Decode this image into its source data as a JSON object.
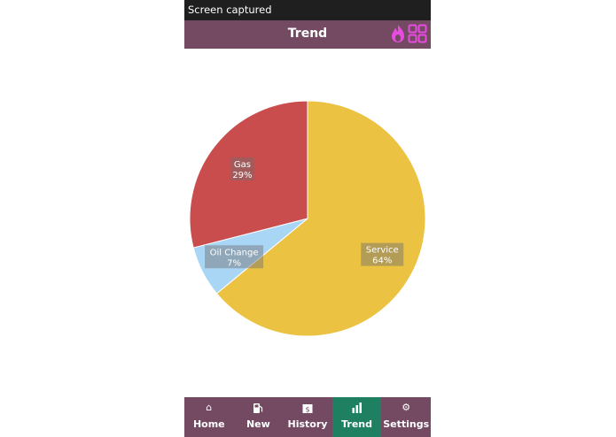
{
  "status_bar": {
    "text": "Screen captured"
  },
  "header": {
    "title": "Trend",
    "icons": [
      "flame-icon",
      "apps-grid-icon"
    ]
  },
  "colors": {
    "header_bg": "#734a62",
    "active_tab_bg": "#1e8060",
    "accent_icon": "#e84be0",
    "service": "#ecc243",
    "gas": "#c94d4d",
    "oil_change": "#aad6f5"
  },
  "chart_data": {
    "type": "pie",
    "slices": [
      {
        "label": "Service",
        "value": 64,
        "percent_label": "64%",
        "color": "#ecc243"
      },
      {
        "label": "Oil Change",
        "value": 7,
        "percent_label": "7%",
        "color": "#aad6f5"
      },
      {
        "label": "Gas",
        "value": 29,
        "percent_label": "29%",
        "color": "#c94d4d"
      }
    ]
  },
  "nav": {
    "items": [
      {
        "label": "Home",
        "icon": "home-icon",
        "active": false
      },
      {
        "label": "New",
        "icon": "fuel-pump-icon",
        "active": false
      },
      {
        "label": "History",
        "icon": "receipt-icon",
        "active": false
      },
      {
        "label": "Trend",
        "icon": "bar-chart-icon",
        "active": true
      },
      {
        "label": "Settings",
        "icon": "gear-icon",
        "active": false
      }
    ]
  }
}
